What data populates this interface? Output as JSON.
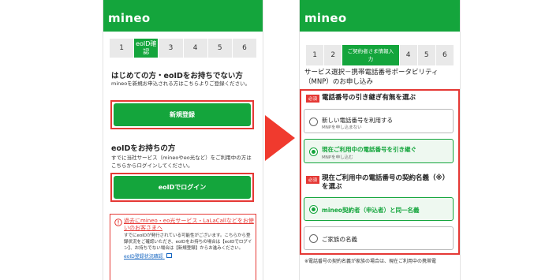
{
  "left": {
    "logo": "mineo",
    "steps": [
      "1",
      "eoID確認",
      "3",
      "4",
      "5",
      "6"
    ],
    "new_heading": "はじめての方・eoIDをお持ちでない方",
    "new_desc": "mineoを新規お申込される方はこちらよりご登録ください。",
    "new_button": "新規登録",
    "have_heading": "eoIDをお持ちの方",
    "have_desc": "すでに当社サービス（mineoやeo光など）をご利用中の方はこちらからログインしてください。",
    "login_button": "eoIDでログイン",
    "notice_title": "過去にmineo・eo光サービス・LaLaCallなどをお使いのお客さまへ",
    "notice_body": "すでにeoIDが発行されている可能性がございます。こちらから登録状況をご確認いただき、eoIDをお持ちの場合は【eoIDでログイン】、お持ちでない場合は【新規登録】からお進みください。",
    "notice_link": "eoID登録状況確認"
  },
  "right": {
    "logo": "mineo",
    "steps": [
      "1",
      "2",
      "ご契約者さま情報入力",
      "4",
      "5",
      "6"
    ],
    "page_title": "サービス選択－携帯電話番号ポータビリティ（MNP）のお申し込み",
    "required_badge": "必須",
    "q1_title": "電話番号の引き継ぎ有無を選ぶ",
    "q1_opt1": "新しい電話番号を利用する",
    "q1_opt1_sub": "MNPを申し込まない",
    "q1_opt2": "現在ご利用中の電話番号を引き継ぐ",
    "q1_opt2_sub": "MNPを申し込む",
    "q2_title": "現在ご利用中の電話番号の契約名義（※）を選ぶ",
    "q2_opt1": "mineo契約者（申込者）と同一名義",
    "q2_opt2": "ご家族の名義",
    "footnote": "※電話番号の契約名義が家族の場合は、現在ご利用中の携帯電"
  },
  "colors": {
    "brand": "#14a53c",
    "accent_red": "#e53935"
  }
}
